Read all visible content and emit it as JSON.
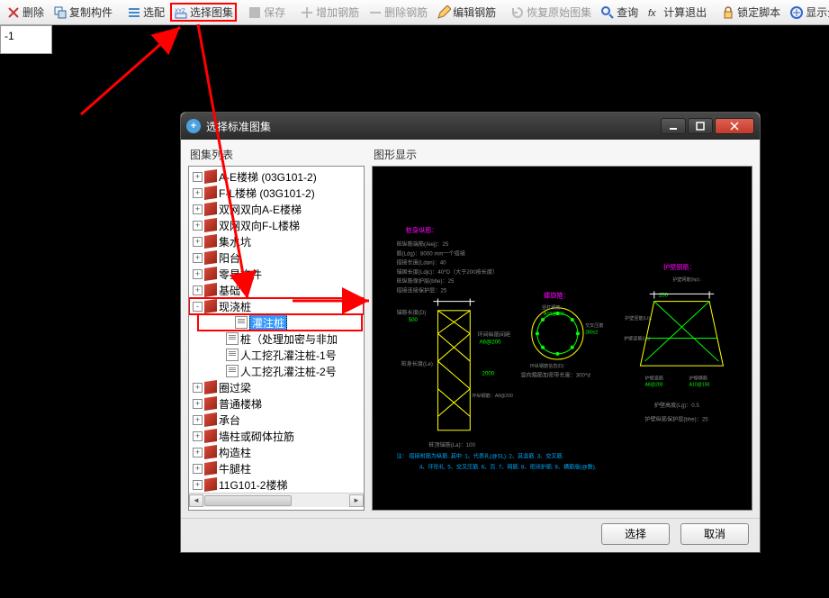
{
  "toolbar": {
    "delete": "删除",
    "copy_component": "复制构件",
    "select_match": "选配",
    "select_atlas": "选择图集",
    "save": "保存",
    "add_rebar": "增加钢筋",
    "delete_rebar": "删除钢筋",
    "edit_rebar": "编辑钢筋",
    "restore_atlas": "恢复原始图集",
    "query": "查询",
    "calc_exit": "计算退出",
    "lock_script": "锁定脚本",
    "show_all": "显示全图"
  },
  "side_panel": {
    "value": "-1"
  },
  "dialog": {
    "title": "选择标准图集",
    "left_title": "图集列表",
    "right_title": "图形显示",
    "select_btn": "选择",
    "cancel_btn": "取消"
  },
  "tree": [
    {
      "label": "A-E楼梯 (03G101-2)",
      "icon": "book",
      "exp": "+"
    },
    {
      "label": "F-L楼梯 (03G101-2)",
      "icon": "book",
      "exp": "+"
    },
    {
      "label": "双网双向A-E楼梯",
      "icon": "book",
      "exp": "+"
    },
    {
      "label": "双网双向F-L楼梯",
      "icon": "book",
      "exp": "+"
    },
    {
      "label": "集水坑",
      "icon": "book",
      "exp": "+"
    },
    {
      "label": "阳台",
      "icon": "book",
      "exp": "+"
    },
    {
      "label": "零星构件",
      "icon": "book",
      "exp": "+"
    },
    {
      "label": "基础",
      "icon": "book",
      "exp": "+"
    },
    {
      "label": "现浇桩",
      "icon": "book-open",
      "exp": "-",
      "parent_boxed": true
    },
    {
      "label": "灌注桩",
      "icon": "page",
      "child": true,
      "selected": true,
      "boxed": true
    },
    {
      "label": "桩（处理加密与非加",
      "icon": "page",
      "child": true
    },
    {
      "label": "人工挖孔灌注桩-1号",
      "icon": "page",
      "child": true
    },
    {
      "label": "人工挖孔灌注桩-2号",
      "icon": "page",
      "child": true
    },
    {
      "label": "圈过梁",
      "icon": "book",
      "exp": "+"
    },
    {
      "label": "普通楼梯",
      "icon": "book",
      "exp": "+"
    },
    {
      "label": "承台",
      "icon": "book",
      "exp": "+"
    },
    {
      "label": "墙柱或砌体拉筋",
      "icon": "book",
      "exp": "+"
    },
    {
      "label": "构造柱",
      "icon": "book",
      "exp": "+"
    },
    {
      "label": "牛腿柱",
      "icon": "book",
      "exp": "+"
    },
    {
      "label": "11G101-2楼梯",
      "icon": "book",
      "exp": "+"
    }
  ],
  "preview_labels": {
    "group1_title": "桩身纵筋：",
    "p_aiej": "桩纵筋端筋(Aiej)：25",
    "p_ldg": "筋(Ldg)：8000 mm一个搭接",
    "p_ldan": "搭接长度(Ldan)：40",
    "p_ldjc": "锚固长度(Ldjc)：40*D（大于200按长度）",
    "p_bhe": "桩纵筋保护层(bhe)：25",
    "p_hhbc": "搭接连接保护层：25",
    "group2_title": "螺旋箍：",
    "p_hjw": "竖杠钢筋：",
    "p_a18200": "A18@200",
    "p_hwwez": "环纵钢筋信息(D)",
    "p_hlb": "竖向箍筋加密带长度：300*d",
    "p_jjj": "交叉压筋",
    "p_28z12": "280±2",
    "group3_title": "护壁钢筋：",
    "p_hbxzj": "护壁网筋(hp)：",
    "p_hbjlq": "护壁竖筋(Lt)：",
    "p_200": "200",
    "p_hbjj": "护壁竖筋",
    "p_a8200": "A8@200",
    "p_hbhj": "护壁横筋",
    "p_a10150": "A10@150",
    "p_hbgd": "护壁高度(Lg)：0.5",
    "p_hbbhc": "护壁纵筋保护层(bhe)：25",
    "sec_500": "500",
    "sec_zscd": "桩身长度(Le)",
    "sec_hjjj": "环间纵筋间距",
    "sec_a6200": "A6@200",
    "sec_2000": "2000",
    "sec_h8200": "环纵钢筋：A8@200",
    "sec_la": "桩顶锚筋(La)：100",
    "note1": "注： 搭接附筋为纵筋. 其中:  1、代表礼(@SL).  2、其竖筋.  3、交叉筋.",
    "note2": "4、环形礼.  5、交叉压筋.  6、页. 7、网筋.  8、密闭护筋.  9、横筋版(@数).  "
  }
}
